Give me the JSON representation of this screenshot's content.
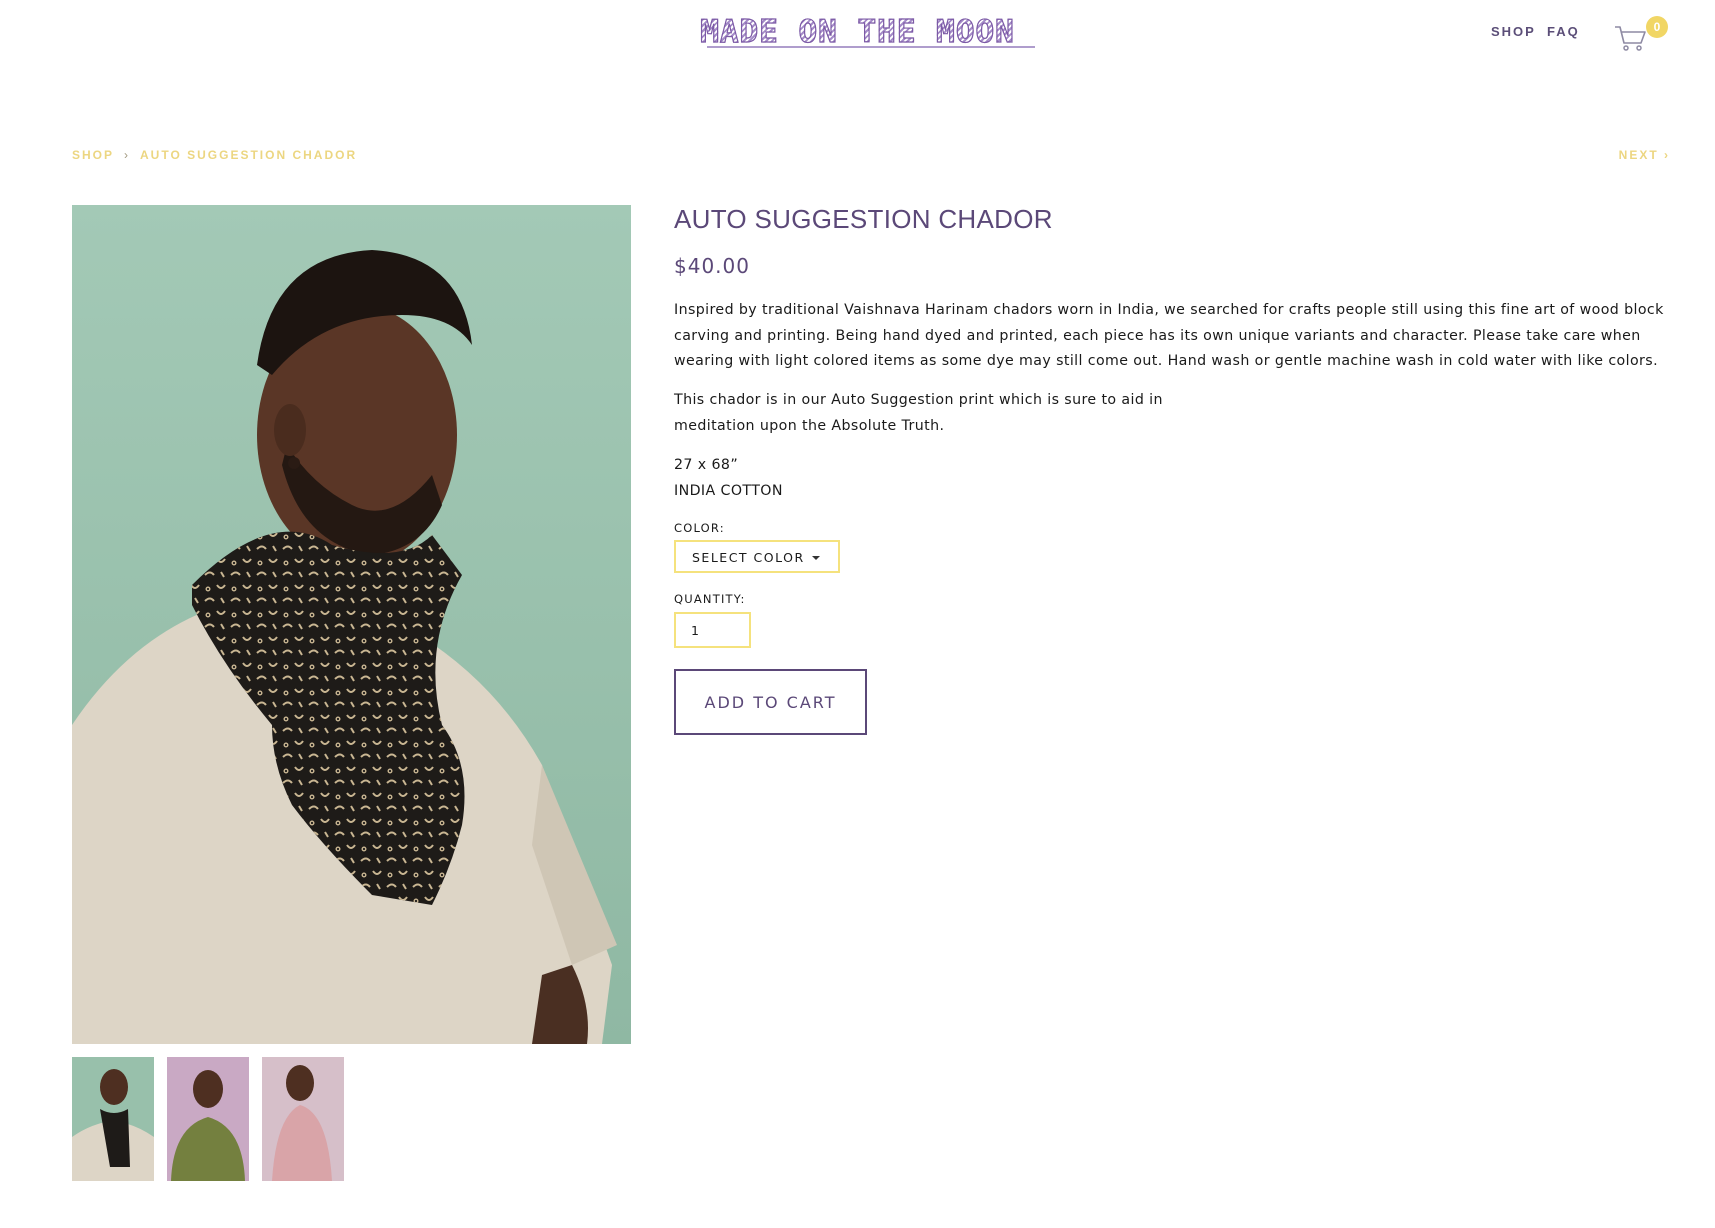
{
  "header": {
    "logo_text": "MADE ON THE MOON",
    "nav": [
      {
        "label": "SHOP"
      },
      {
        "label": "FAQ"
      }
    ],
    "cart_count": "0"
  },
  "breadcrumb": {
    "shop": "SHOP",
    "separator": "›",
    "current": "AUTO SUGGESTION CHADOR",
    "next": "NEXT ›"
  },
  "product": {
    "title": "AUTO SUGGESTION CHADOR",
    "price": "$40.00",
    "description": "Inspired by traditional Vaishnava Harinam chadors worn in India, we searched for crafts people still using this fine art of wood block carving and printing. Being hand dyed and printed, each piece has its own unique variants and character. Please take care when wearing with light colored items as some dye may still come out. Hand wash or gentle machine wash in cold water with like colors.",
    "description_2": "This chador is in our Auto Suggestion print which is sure to aid in meditation upon the Absolute Truth.",
    "size": "27 x 68”",
    "material": "INDIA COTTON",
    "color_label": "COLOR:",
    "color_select": "SELECT COLOR",
    "quantity_label": "QUANTITY:",
    "quantity_value": "1",
    "add_to_cart": "ADD TO CART"
  },
  "colors": {
    "accent_purple": "#5b4878",
    "accent_yellow": "#f5e27d",
    "photo_background": "#98c0ab",
    "thumbnail_backgrounds": [
      "#98c0ab",
      "#c9a9c4",
      "#d6bfc9"
    ],
    "scarf_colors": [
      "#1e1b18",
      "#74803f",
      "#d9a4a8"
    ]
  }
}
